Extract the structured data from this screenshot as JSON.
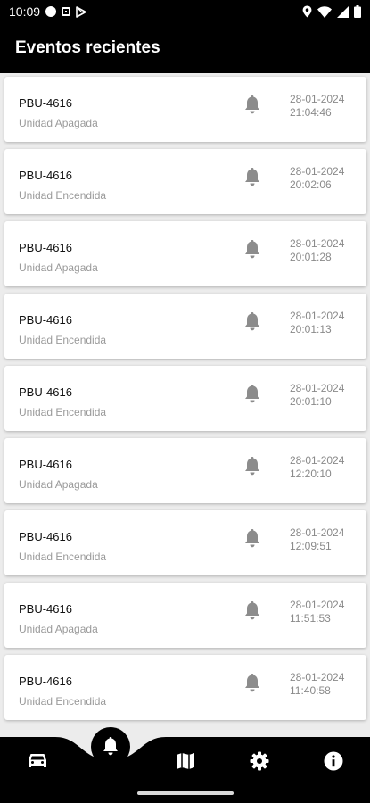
{
  "status_bar": {
    "time": "10:09",
    "left_icons": [
      "notification-dot-icon",
      "square-app-icon",
      "play-store-icon"
    ],
    "right_icons": [
      "location-icon",
      "wifi-icon",
      "signal-icon",
      "battery-icon"
    ]
  },
  "app_bar": {
    "title": "Eventos recientes"
  },
  "events": [
    {
      "plate": "PBU-4616",
      "event": "Unidad Apagada",
      "date": "28-01-2024",
      "time": "21:04:46"
    },
    {
      "plate": "PBU-4616",
      "event": "Unidad Encendida",
      "date": "28-01-2024",
      "time": "20:02:06"
    },
    {
      "plate": "PBU-4616",
      "event": "Unidad Apagada",
      "date": "28-01-2024",
      "time": "20:01:28"
    },
    {
      "plate": "PBU-4616",
      "event": "Unidad Encendida",
      "date": "28-01-2024",
      "time": "20:01:13"
    },
    {
      "plate": "PBU-4616",
      "event": "Unidad Encendida",
      "date": "28-01-2024",
      "time": "20:01:10"
    },
    {
      "plate": "PBU-4616",
      "event": "Unidad Apagada",
      "date": "28-01-2024",
      "time": "12:20:10"
    },
    {
      "plate": "PBU-4616",
      "event": "Unidad Encendida",
      "date": "28-01-2024",
      "time": "12:09:51"
    },
    {
      "plate": "PBU-4616",
      "event": "Unidad Apagada",
      "date": "28-01-2024",
      "time": "11:51:53"
    },
    {
      "plate": "PBU-4616",
      "event": "Unidad Encendida",
      "date": "28-01-2024",
      "time": "11:40:58"
    }
  ],
  "bottom_nav": {
    "items": [
      "car-icon",
      "bell-icon",
      "map-icon",
      "gear-icon",
      "info-icon"
    ],
    "active": "bell-icon"
  },
  "colors": {
    "app_bar": "#000000",
    "background": "#ececec",
    "card": "#ffffff",
    "secondary_text": "#9a9a9a",
    "bell": "#8c8c8c"
  }
}
